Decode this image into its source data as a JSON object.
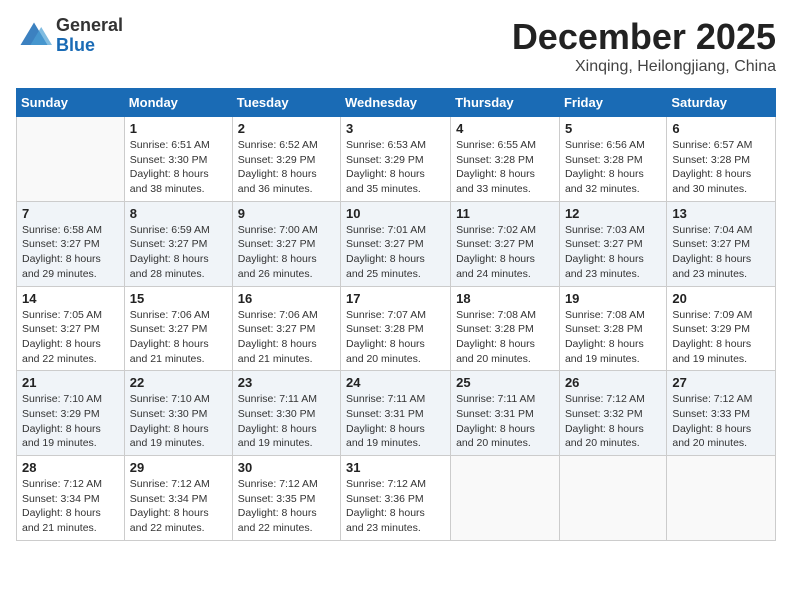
{
  "header": {
    "logo_general": "General",
    "logo_blue": "Blue",
    "month_title": "December 2025",
    "location": "Xinqing, Heilongjiang, China"
  },
  "days_of_week": [
    "Sunday",
    "Monday",
    "Tuesday",
    "Wednesday",
    "Thursday",
    "Friday",
    "Saturday"
  ],
  "weeks": [
    [
      {
        "day": "",
        "sunrise": "",
        "sunset": "",
        "daylight": ""
      },
      {
        "day": "1",
        "sunrise": "Sunrise: 6:51 AM",
        "sunset": "Sunset: 3:30 PM",
        "daylight": "Daylight: 8 hours and 38 minutes."
      },
      {
        "day": "2",
        "sunrise": "Sunrise: 6:52 AM",
        "sunset": "Sunset: 3:29 PM",
        "daylight": "Daylight: 8 hours and 36 minutes."
      },
      {
        "day": "3",
        "sunrise": "Sunrise: 6:53 AM",
        "sunset": "Sunset: 3:29 PM",
        "daylight": "Daylight: 8 hours and 35 minutes."
      },
      {
        "day": "4",
        "sunrise": "Sunrise: 6:55 AM",
        "sunset": "Sunset: 3:28 PM",
        "daylight": "Daylight: 8 hours and 33 minutes."
      },
      {
        "day": "5",
        "sunrise": "Sunrise: 6:56 AM",
        "sunset": "Sunset: 3:28 PM",
        "daylight": "Daylight: 8 hours and 32 minutes."
      },
      {
        "day": "6",
        "sunrise": "Sunrise: 6:57 AM",
        "sunset": "Sunset: 3:28 PM",
        "daylight": "Daylight: 8 hours and 30 minutes."
      }
    ],
    [
      {
        "day": "7",
        "sunrise": "Sunrise: 6:58 AM",
        "sunset": "Sunset: 3:27 PM",
        "daylight": "Daylight: 8 hours and 29 minutes."
      },
      {
        "day": "8",
        "sunrise": "Sunrise: 6:59 AM",
        "sunset": "Sunset: 3:27 PM",
        "daylight": "Daylight: 8 hours and 28 minutes."
      },
      {
        "day": "9",
        "sunrise": "Sunrise: 7:00 AM",
        "sunset": "Sunset: 3:27 PM",
        "daylight": "Daylight: 8 hours and 26 minutes."
      },
      {
        "day": "10",
        "sunrise": "Sunrise: 7:01 AM",
        "sunset": "Sunset: 3:27 PM",
        "daylight": "Daylight: 8 hours and 25 minutes."
      },
      {
        "day": "11",
        "sunrise": "Sunrise: 7:02 AM",
        "sunset": "Sunset: 3:27 PM",
        "daylight": "Daylight: 8 hours and 24 minutes."
      },
      {
        "day": "12",
        "sunrise": "Sunrise: 7:03 AM",
        "sunset": "Sunset: 3:27 PM",
        "daylight": "Daylight: 8 hours and 23 minutes."
      },
      {
        "day": "13",
        "sunrise": "Sunrise: 7:04 AM",
        "sunset": "Sunset: 3:27 PM",
        "daylight": "Daylight: 8 hours and 23 minutes."
      }
    ],
    [
      {
        "day": "14",
        "sunrise": "Sunrise: 7:05 AM",
        "sunset": "Sunset: 3:27 PM",
        "daylight": "Daylight: 8 hours and 22 minutes."
      },
      {
        "day": "15",
        "sunrise": "Sunrise: 7:06 AM",
        "sunset": "Sunset: 3:27 PM",
        "daylight": "Daylight: 8 hours and 21 minutes."
      },
      {
        "day": "16",
        "sunrise": "Sunrise: 7:06 AM",
        "sunset": "Sunset: 3:27 PM",
        "daylight": "Daylight: 8 hours and 21 minutes."
      },
      {
        "day": "17",
        "sunrise": "Sunrise: 7:07 AM",
        "sunset": "Sunset: 3:28 PM",
        "daylight": "Daylight: 8 hours and 20 minutes."
      },
      {
        "day": "18",
        "sunrise": "Sunrise: 7:08 AM",
        "sunset": "Sunset: 3:28 PM",
        "daylight": "Daylight: 8 hours and 20 minutes."
      },
      {
        "day": "19",
        "sunrise": "Sunrise: 7:08 AM",
        "sunset": "Sunset: 3:28 PM",
        "daylight": "Daylight: 8 hours and 19 minutes."
      },
      {
        "day": "20",
        "sunrise": "Sunrise: 7:09 AM",
        "sunset": "Sunset: 3:29 PM",
        "daylight": "Daylight: 8 hours and 19 minutes."
      }
    ],
    [
      {
        "day": "21",
        "sunrise": "Sunrise: 7:10 AM",
        "sunset": "Sunset: 3:29 PM",
        "daylight": "Daylight: 8 hours and 19 minutes."
      },
      {
        "day": "22",
        "sunrise": "Sunrise: 7:10 AM",
        "sunset": "Sunset: 3:30 PM",
        "daylight": "Daylight: 8 hours and 19 minutes."
      },
      {
        "day": "23",
        "sunrise": "Sunrise: 7:11 AM",
        "sunset": "Sunset: 3:30 PM",
        "daylight": "Daylight: 8 hours and 19 minutes."
      },
      {
        "day": "24",
        "sunrise": "Sunrise: 7:11 AM",
        "sunset": "Sunset: 3:31 PM",
        "daylight": "Daylight: 8 hours and 19 minutes."
      },
      {
        "day": "25",
        "sunrise": "Sunrise: 7:11 AM",
        "sunset": "Sunset: 3:31 PM",
        "daylight": "Daylight: 8 hours and 20 minutes."
      },
      {
        "day": "26",
        "sunrise": "Sunrise: 7:12 AM",
        "sunset": "Sunset: 3:32 PM",
        "daylight": "Daylight: 8 hours and 20 minutes."
      },
      {
        "day": "27",
        "sunrise": "Sunrise: 7:12 AM",
        "sunset": "Sunset: 3:33 PM",
        "daylight": "Daylight: 8 hours and 20 minutes."
      }
    ],
    [
      {
        "day": "28",
        "sunrise": "Sunrise: 7:12 AM",
        "sunset": "Sunset: 3:34 PM",
        "daylight": "Daylight: 8 hours and 21 minutes."
      },
      {
        "day": "29",
        "sunrise": "Sunrise: 7:12 AM",
        "sunset": "Sunset: 3:34 PM",
        "daylight": "Daylight: 8 hours and 22 minutes."
      },
      {
        "day": "30",
        "sunrise": "Sunrise: 7:12 AM",
        "sunset": "Sunset: 3:35 PM",
        "daylight": "Daylight: 8 hours and 22 minutes."
      },
      {
        "day": "31",
        "sunrise": "Sunrise: 7:12 AM",
        "sunset": "Sunset: 3:36 PM",
        "daylight": "Daylight: 8 hours and 23 minutes."
      },
      {
        "day": "",
        "sunrise": "",
        "sunset": "",
        "daylight": ""
      },
      {
        "day": "",
        "sunrise": "",
        "sunset": "",
        "daylight": ""
      },
      {
        "day": "",
        "sunrise": "",
        "sunset": "",
        "daylight": ""
      }
    ]
  ]
}
